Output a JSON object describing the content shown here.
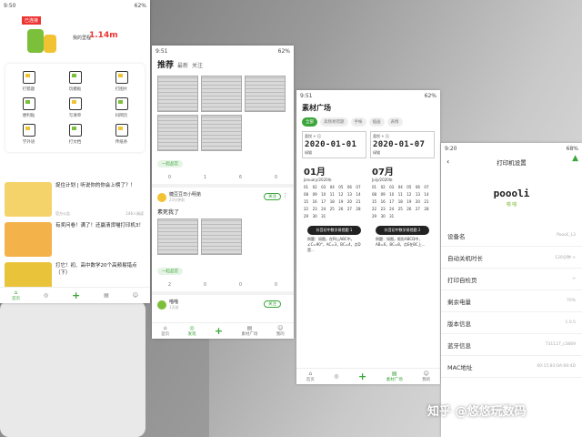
{
  "phone1": {
    "status_time": "9:50",
    "status_battery": "62%",
    "banner": {
      "tag": "已连接",
      "label": "我的里程",
      "distance": "1.14m"
    },
    "grid": [
      {
        "label": "打错题",
        "icon": "wrong-question-icon"
      },
      {
        "label": "玩模板",
        "icon": "template-icon"
      },
      {
        "label": "打图片",
        "icon": "image-icon"
      },
      {
        "label": "便利贴",
        "icon": "sticky-note-icon"
      },
      {
        "label": "写清单",
        "icon": "checklist-icon"
      },
      {
        "label": "扫网页",
        "icon": "web-scan-icon"
      },
      {
        "label": "学外语",
        "icon": "language-icon"
      },
      {
        "label": "打文档",
        "icon": "document-icon"
      },
      {
        "label": "传纸条",
        "icon": "note-pass-icon"
      }
    ],
    "articles": [
      {
        "title": "捉住计划 | 听说你的你会上榜了？！",
        "source": "官方公告",
        "reads": "146人阅读"
      },
      {
        "title": "有奖问卷！满了！还赢清货喵打印机3！",
        "source": "",
        "reads": ""
      },
      {
        "title": "打它！初、高中数学20个高频易错点（下）",
        "source": "学习干货",
        "reads": "1915人阅读"
      }
    ],
    "tabs": [
      "首页",
      "",
      "",
      "",
      ""
    ]
  },
  "phone2": {
    "status_time": "9:51",
    "status_battery": "62%",
    "tab_main": "推荐",
    "tab_new": "最新",
    "tab_follow": "关注",
    "chip1": "一起品宫",
    "metrics1": [
      "0",
      "1",
      "6",
      "0"
    ],
    "post_user": "糖豆豆日小明弟",
    "post_time": "23分钟前",
    "post_follow": "关注",
    "post_text": "素死我了",
    "chip2": "一起品宫",
    "metrics2": [
      "2",
      "0",
      "0",
      "0"
    ],
    "post2_user": "喵喵",
    "post2_time": "1天前",
    "post2_follow": "关注",
    "tabs": [
      "首页",
      "发现",
      "",
      "素材广场",
      "我的"
    ]
  },
  "phone3": {
    "status_time": "9:51",
    "status_battery": "62%",
    "title": "素材广场",
    "cats": [
      "全部",
      "高频易错题",
      "手帐",
      "插画",
      "表情"
    ],
    "cards": [
      {
        "small": "喜悦 + 日",
        "date": "2020-01-01",
        "user": "绿猫"
      },
      {
        "small": "喜悦 + 日",
        "date": "2020-01-07",
        "user": "绿猫"
      }
    ],
    "cal1": {
      "month": "01月",
      "sub": "January/2020年"
    },
    "cal2": {
      "month": "07月",
      "sub": "July/2020年"
    },
    "days": [
      "01",
      "02",
      "03",
      "04",
      "05",
      "06",
      "07",
      "08",
      "09",
      "10",
      "11",
      "12",
      "13",
      "14",
      "15",
      "16",
      "17",
      "18",
      "19",
      "20",
      "21",
      "22",
      "23",
      "24",
      "25",
      "26",
      "27",
      "28",
      "29",
      "30",
      "31"
    ],
    "banner_left": "抖音初中数学易错题 1",
    "banner_right": "抖音初中数学易错题 2",
    "q_left": "例题：如图，在Rt△ABC中，∠C=90°，AC=3，BC=4，点D是...",
    "q_right": "例题：如图，矩形ABCD中，AB=6，BC=8，点E在BC上...",
    "tabs": [
      "首页",
      "",
      "",
      "素材广场",
      "我的"
    ]
  },
  "phone4": {
    "status_time": "9:20",
    "status_battery": "68%",
    "title": "打印机设置",
    "logo_word": "poooli",
    "logo_sub": "喵 喵",
    "rows": [
      {
        "label": "设备名",
        "value": "Poooli_L3"
      },
      {
        "label": "自动关机时长",
        "value": "120分钟 >"
      },
      {
        "label": "打印自检页",
        "value": ">"
      },
      {
        "label": "剩余电量",
        "value": "70%"
      },
      {
        "label": "版本信息",
        "value": "1.0.5"
      },
      {
        "label": "蓝牙信息",
        "value": "T31127_c3869"
      },
      {
        "label": "MAC地址",
        "value": "00:15:83:0A:69:4D"
      }
    ]
  },
  "watermark": "知乎 @悠悠玩数码",
  "colors": {
    "accent": "#3aa53a",
    "alert": "#e33333",
    "yellow": "#f1c232"
  }
}
